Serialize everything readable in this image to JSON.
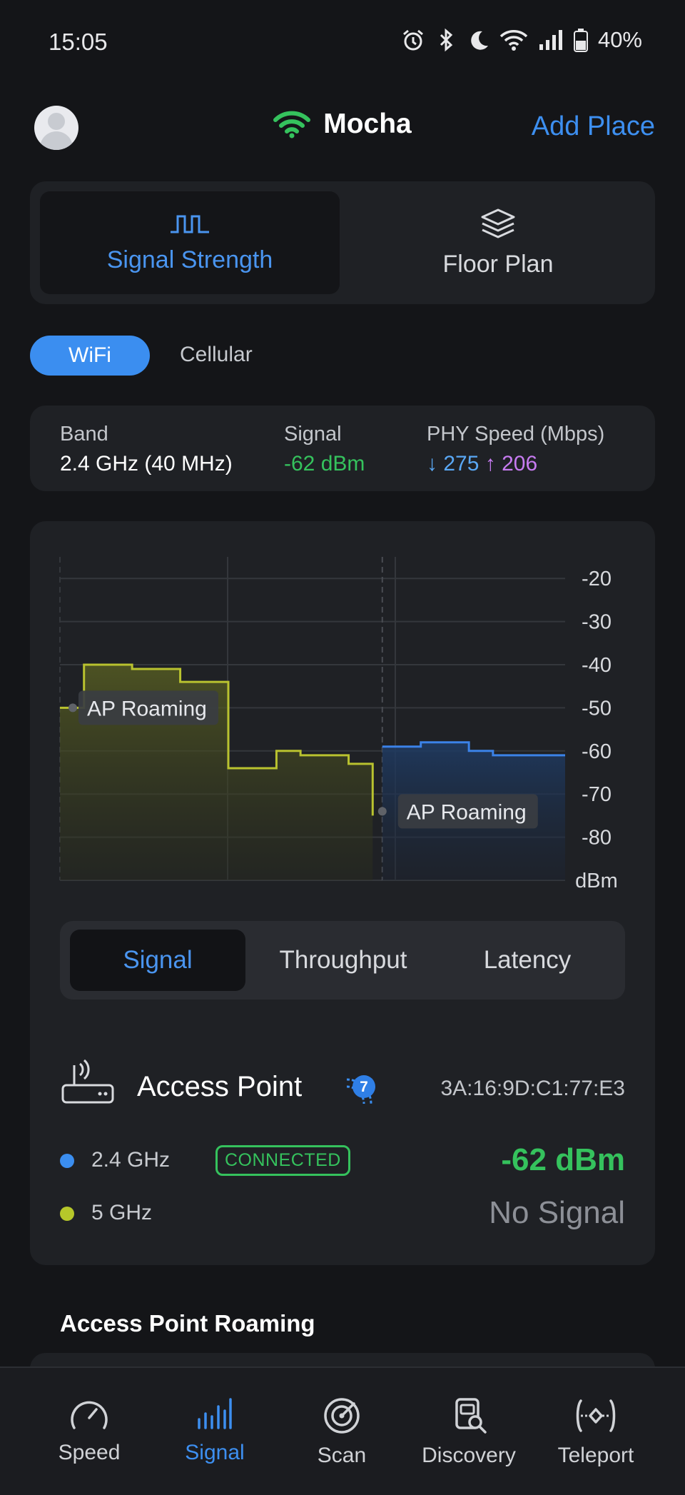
{
  "status_bar": {
    "time": "15:05",
    "battery": "40%"
  },
  "header": {
    "place_name": "Mocha",
    "add_place": "Add Place"
  },
  "mode_tabs": [
    {
      "label": "Signal Strength",
      "active": true
    },
    {
      "label": "Floor Plan",
      "active": false
    }
  ],
  "network_tabs": {
    "wifi": "WiFi",
    "cellular": "Cellular"
  },
  "info": {
    "band_label": "Band",
    "band_value": "2.4 GHz (40 MHz)",
    "signal_label": "Signal",
    "signal_value": "-62 dBm",
    "phy_label": "PHY Speed (Mbps)",
    "down_arrow": "↓",
    "down_value": "275",
    "up_arrow": "↑",
    "up_value": "206"
  },
  "chart_data": {
    "type": "line",
    "ylabel": "dBm",
    "y_ticks": [
      "-20",
      "-30",
      "-40",
      "-50",
      "-60",
      "-70",
      "-80"
    ],
    "ylim": [
      -90,
      -15
    ],
    "annotations": [
      "AP Roaming",
      "AP Roaming"
    ],
    "series": [
      {
        "color": "#b9c22f",
        "x": [
          0,
          10,
          20,
          30,
          40,
          50,
          60,
          70,
          80,
          90,
          100,
          110,
          120,
          130
        ],
        "values": [
          -50,
          -40,
          -40,
          -41,
          -41,
          -44,
          -44,
          -64,
          -64,
          -60,
          -61,
          -61,
          -63,
          -75
        ]
      },
      {
        "color": "#3b82e8",
        "x": [
          134,
          140,
          150,
          160,
          170,
          180,
          190,
          200,
          210
        ],
        "values": [
          -59,
          -59,
          -58,
          -58,
          -60,
          -61,
          -61,
          -61,
          -61
        ]
      }
    ],
    "colors": {
      "series_a": "#b9c22f",
      "series_b": "#3b82e8"
    },
    "grid": true
  },
  "chart_tabs": [
    "Signal",
    "Throughput",
    "Latency"
  ],
  "access_point": {
    "title": "Access Point",
    "badge_count": "7",
    "mac": "3A:16:9D:C1:77:E3",
    "bands": [
      {
        "label": "2.4 GHz",
        "status": "CONNECTED",
        "value": "-62 dBm",
        "color": "#3b8ef0"
      },
      {
        "label": "5 GHz",
        "value": "No Signal",
        "color": "#b6c72a"
      }
    ]
  },
  "roaming_section": {
    "title": "Access Point Roaming"
  },
  "bottom_nav": [
    {
      "label": "Speed",
      "icon": "speedometer-icon"
    },
    {
      "label": "Signal",
      "icon": "signal-bars-icon",
      "active": true
    },
    {
      "label": "Scan",
      "icon": "radar-icon"
    },
    {
      "label": "Discovery",
      "icon": "device-search-icon"
    },
    {
      "label": "Teleport",
      "icon": "teleport-icon"
    }
  ]
}
